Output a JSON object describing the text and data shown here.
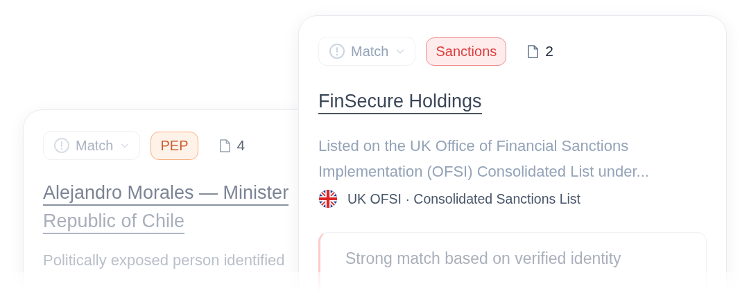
{
  "cards": [
    {
      "faded": true,
      "match": "Match",
      "tag": {
        "kind": "pep",
        "label": "PEP"
      },
      "documents": "4",
      "title_lines": [
        "Alejandro Morales — Minister",
        "Republic of Chile"
      ],
      "description_lines": [
        "Politically exposed person identified"
      ]
    },
    {
      "faded": false,
      "match": "Match",
      "tag": {
        "kind": "sanctions",
        "label": "Sanctions"
      },
      "documents": "2",
      "title_lines": [
        "FinSecure Holdings"
      ],
      "description_lines": [
        "Listed on the UK Office of Financial Sanctions",
        "Implementation (OFSI) Consolidated List under..."
      ],
      "source": "UK OFSI · Consolidated Sanctions List",
      "note": "Strong match based on verified identity"
    }
  ]
}
